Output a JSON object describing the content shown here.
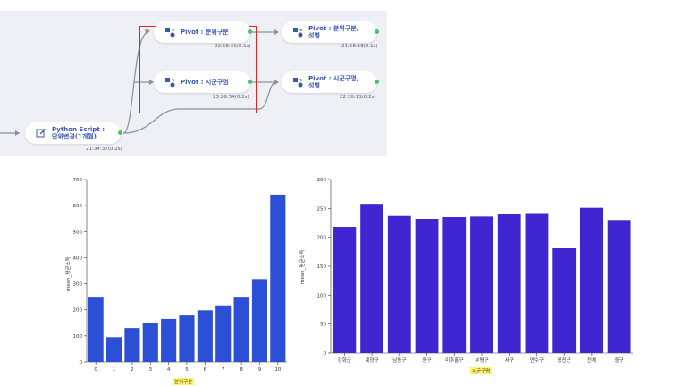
{
  "flow": {
    "nodes": [
      {
        "id": "python",
        "title": "Python Script :\n단위변경(1개월)",
        "time": "21:34:37(0.2s)",
        "icon": "edit-icon"
      },
      {
        "id": "pivot1",
        "title": "Pivot : 분위구분",
        "time": "22:58:31(0.1s)",
        "icon": "pivot-icon"
      },
      {
        "id": "pivot2",
        "title": "Pivot : 시군구명",
        "time": "23:26:54(0.2s)",
        "icon": "pivot-icon"
      },
      {
        "id": "pivot3",
        "title": "Pivot : 분위구분,\n성별",
        "time": "21:58:18(0.1s)",
        "icon": "pivot-icon"
      },
      {
        "id": "pivot4",
        "title": "Pivot : 시군구명,\n성별",
        "time": "22:36:13(0.2s)",
        "icon": "pivot-icon"
      }
    ],
    "colors": {
      "node_text": "#3a55b4",
      "status_dot": "#3cc76a",
      "highlight": "#e02424"
    }
  },
  "chart_data": [
    {
      "type": "bar",
      "categories": [
        "0",
        "1",
        "2",
        "3",
        "4",
        "5",
        "6",
        "7",
        "8",
        "9",
        "10"
      ],
      "values": [
        250,
        95,
        130,
        150,
        165,
        178,
        198,
        217,
        250,
        318,
        642
      ],
      "xlabel": "분위구분",
      "ylabel": "mean_평균소득",
      "ylim": [
        0,
        700
      ],
      "yticks": [
        "0",
        "100",
        "200",
        "300",
        "400",
        "500",
        "600",
        "700"
      ],
      "color": "#2d4fd6"
    },
    {
      "type": "bar",
      "categories": [
        "강화군",
        "계양구",
        "남동구",
        "동구",
        "미추홀구",
        "부평구",
        "서구",
        "연수구",
        "옹진군",
        "전체",
        "중구"
      ],
      "values": [
        218,
        258,
        237,
        232,
        235,
        236,
        241,
        242,
        181,
        251,
        230
      ],
      "xlabel": "시군구명",
      "ylabel": "mean_평균소득",
      "ylim": [
        0,
        300
      ],
      "yticks": [
        "0",
        "50",
        "100",
        "150",
        "200",
        "250",
        "300"
      ],
      "color": "#3f26d0"
    }
  ]
}
